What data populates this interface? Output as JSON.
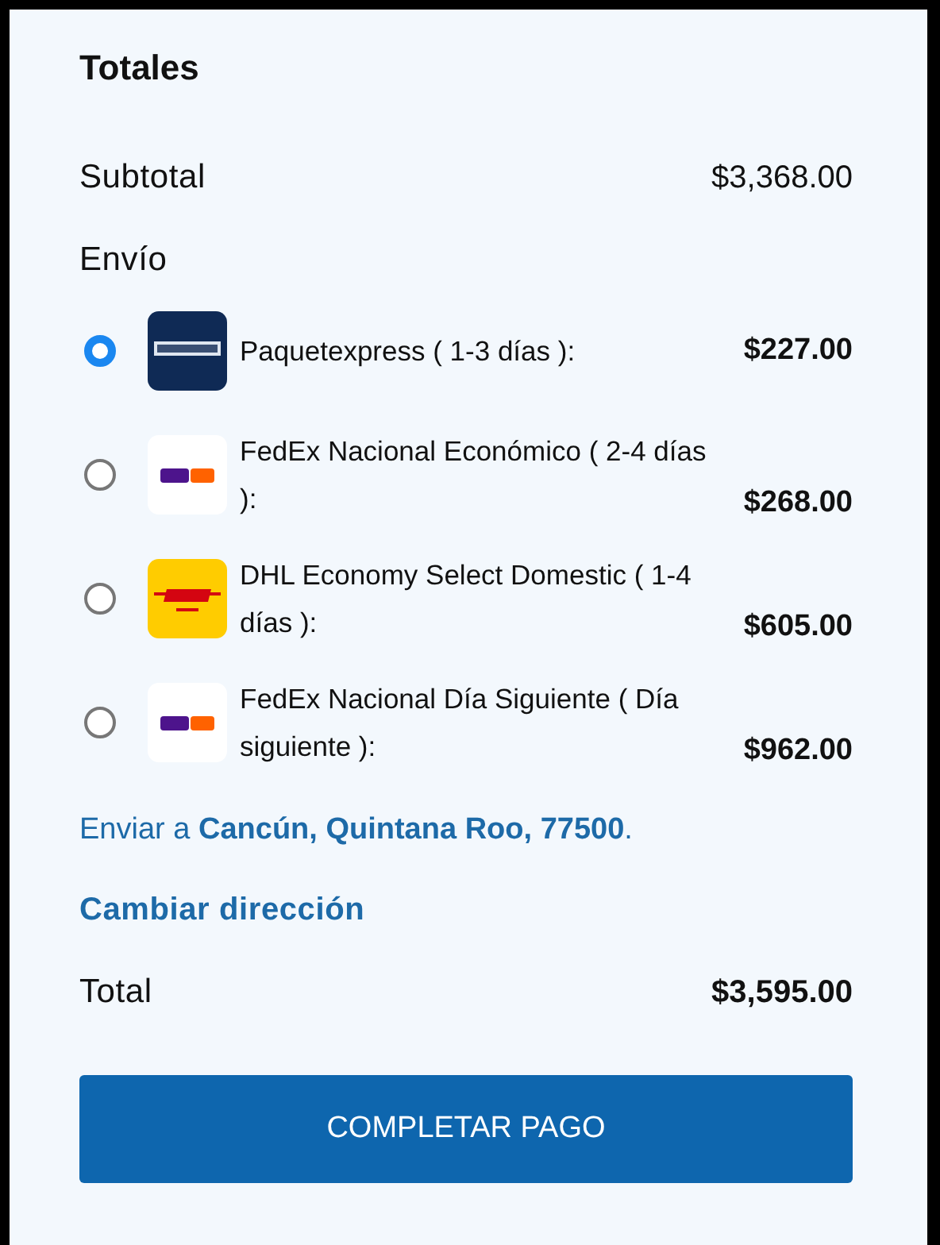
{
  "title": "Totales",
  "subtotal": {
    "label": "Subtotal",
    "value": "$3,368.00"
  },
  "shipping": {
    "label": "Envío",
    "options": [
      {
        "kind": "paquetexpress",
        "label": "Paquetexpress ( 1-3 días ):",
        "price": "$227.00",
        "selected": true
      },
      {
        "kind": "fedex",
        "label": "FedEx Nacional Económico ( 2-4 días ):",
        "price": "$268.00",
        "selected": false
      },
      {
        "kind": "dhl",
        "label": "DHL Economy Select Domestic ( 1-4 días ):",
        "price": "$605.00",
        "selected": false
      },
      {
        "kind": "fedex",
        "label": "FedEx Nacional Día Siguiente ( Día siguiente ):",
        "price": "$962.00",
        "selected": false
      }
    ]
  },
  "ship_to": "Enviar a **Cancún, Quintana Roo, 77500**.",
  "change_address": "Cambiar dirección",
  "total": {
    "label": "Total",
    "value": "$3,595.00"
  },
  "button": "COMPLETAR PAGO"
}
